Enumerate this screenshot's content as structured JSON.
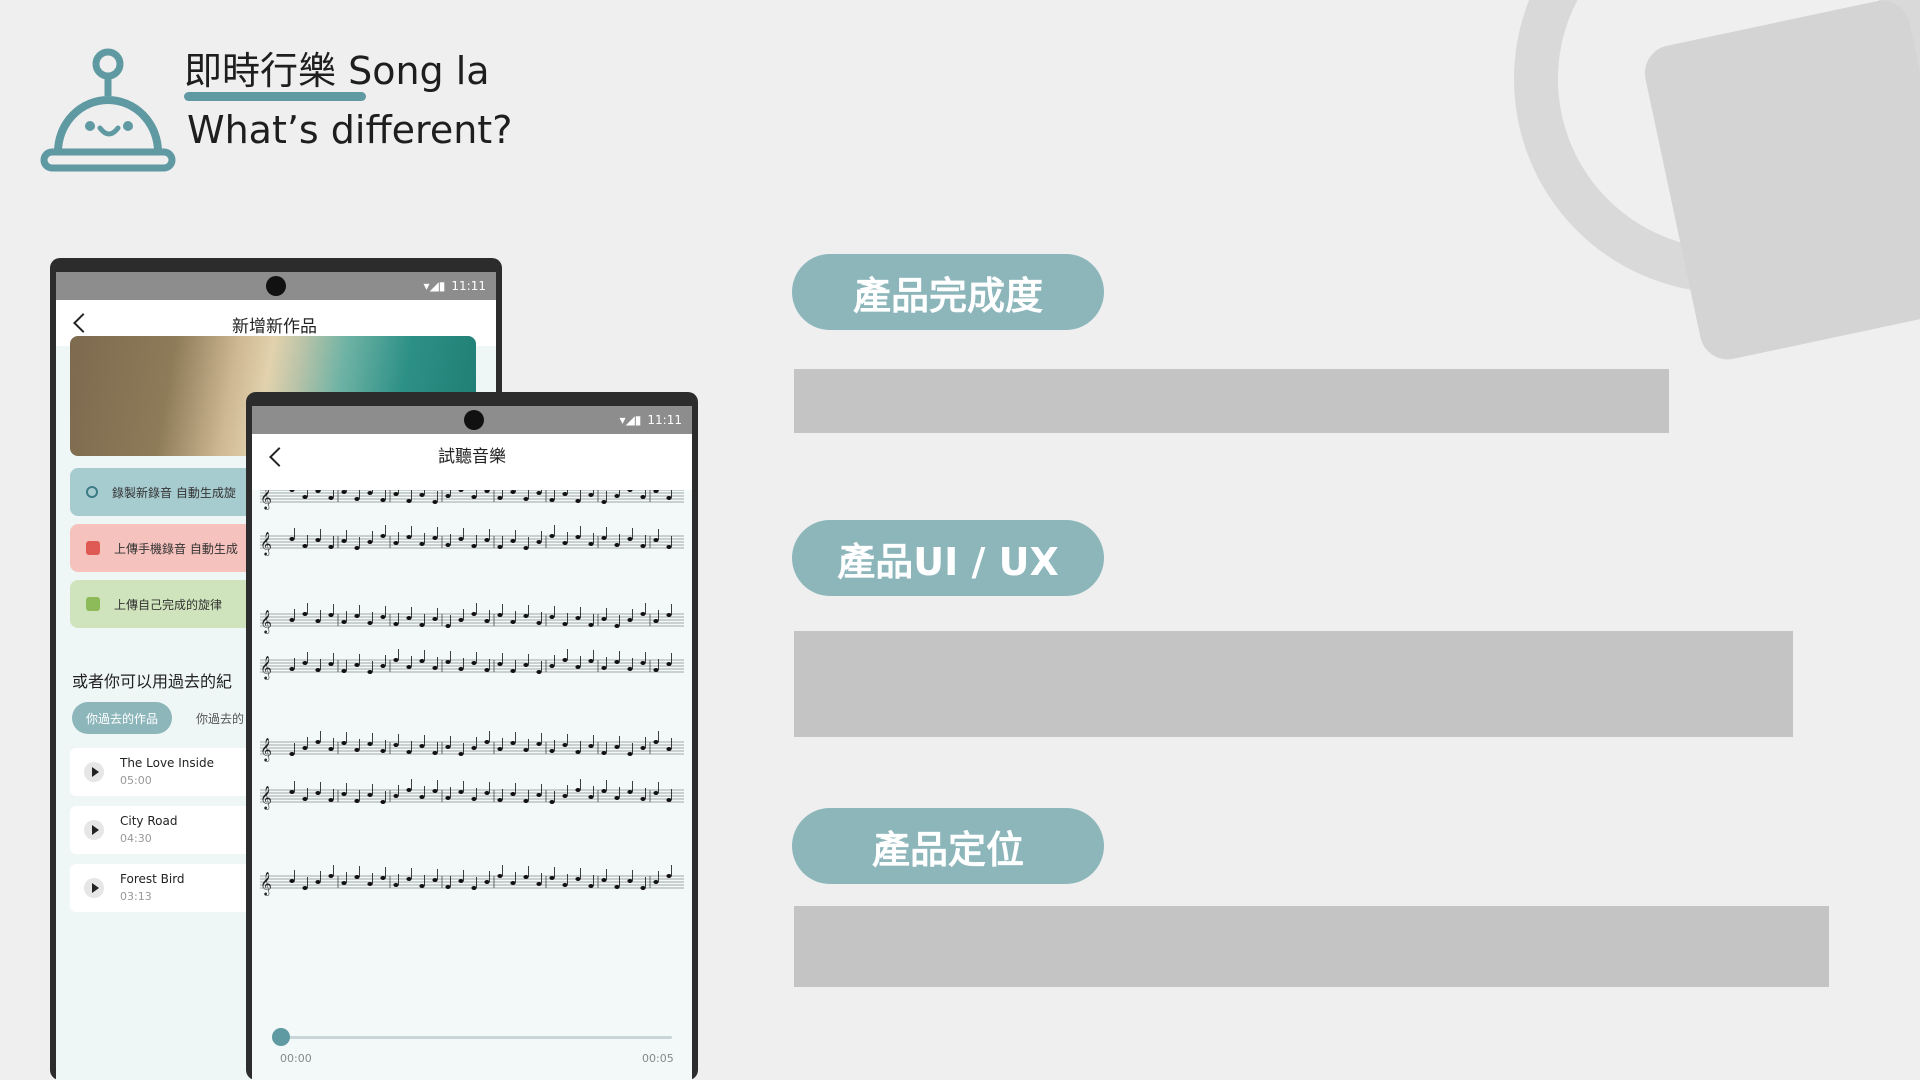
{
  "header": {
    "title": "即時行樂 Song la",
    "subtitle": "What’s different?"
  },
  "sections": [
    {
      "label": "產品完成度"
    },
    {
      "label": "產品UI / UX"
    },
    {
      "label": "產品定位"
    }
  ],
  "phone_create": {
    "status_time": "11:11",
    "title": "新增新作品",
    "actions": [
      {
        "label": "錄製新錄音 自動生成旋",
        "icon": "search-icon"
      },
      {
        "label": "上傳手機錄音 自動生成",
        "icon": "folder-icon"
      },
      {
        "label": "上傳自己完成的旋律",
        "icon": "folder-icon"
      }
    ],
    "past_label": "或者你可以用過去的紀",
    "tabs": [
      "你過去的作品",
      "你過去的"
    ],
    "songs": [
      {
        "name": "The Love Inside",
        "duration": "05:00"
      },
      {
        "name": "City Road",
        "duration": "04:30"
      },
      {
        "name": "Forest Bird",
        "duration": "03:13"
      }
    ]
  },
  "phone_listen": {
    "status_time": "11:11",
    "title": "試聽音樂",
    "time_start": "00:00",
    "time_end": "00:05",
    "progress": 0.0
  },
  "colors": {
    "accent": "#5f9aa2",
    "pill": "#8db6bb",
    "bar": "#c4c4c4"
  }
}
